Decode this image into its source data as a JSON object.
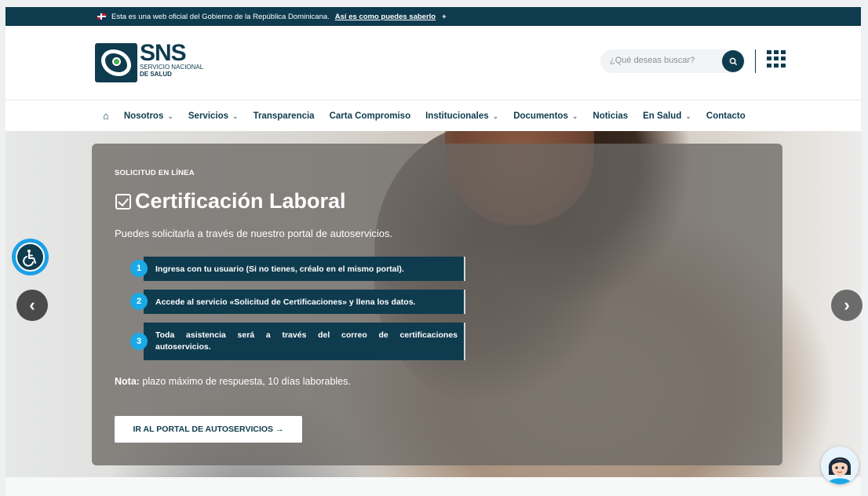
{
  "gov_banner": {
    "text": "Esta es una web oficial del Gobierno de la República Dominicana.",
    "link": "Así es como puedes saberlo",
    "toggle": "+"
  },
  "logo": {
    "acronym": "SNS",
    "line1": "SERVICIO NACIONAL",
    "line2": "DE SALUD"
  },
  "search": {
    "placeholder": "¿Qué deseas buscar?"
  },
  "nav": {
    "items": [
      {
        "label": "Nosotros",
        "has_dropdown": true
      },
      {
        "label": "Servicios",
        "has_dropdown": true
      },
      {
        "label": "Transparencia",
        "has_dropdown": false
      },
      {
        "label": "Carta Compromiso",
        "has_dropdown": false
      },
      {
        "label": "Institucionales",
        "has_dropdown": true
      },
      {
        "label": "Documentos",
        "has_dropdown": true
      },
      {
        "label": "Noticias",
        "has_dropdown": false
      },
      {
        "label": "En Salud",
        "has_dropdown": true
      },
      {
        "label": "Contacto",
        "has_dropdown": false
      }
    ],
    "chevron": "⌄"
  },
  "hero": {
    "eyebrow": "SOLICITUD EN LÍNEA",
    "title": "Certificación Laboral",
    "description": "Puedes solicitarla a través de nuestro portal de autoservicios.",
    "steps": [
      {
        "num": "1",
        "text": "Ingresa con tu usuario (Si no tienes, créalo en el mismo portal)."
      },
      {
        "num": "2",
        "text": "Accede al servicio «Solicitud de Certificaciones» y llena los datos."
      },
      {
        "num": "3",
        "text": "Toda asistencia será a través del correo de certificaciones autoservicios."
      }
    ],
    "note_label": "Nota:",
    "note_text": " plazo máximo de respuesta, 10 días laborables.",
    "cta": "IR AL PORTAL DE AUTOSERVICIOS →"
  },
  "carousel": {
    "prev": "‹",
    "next": "›"
  },
  "colors": {
    "brand_dark": "#0f3b4e",
    "accent_blue": "#1aa9e6"
  }
}
